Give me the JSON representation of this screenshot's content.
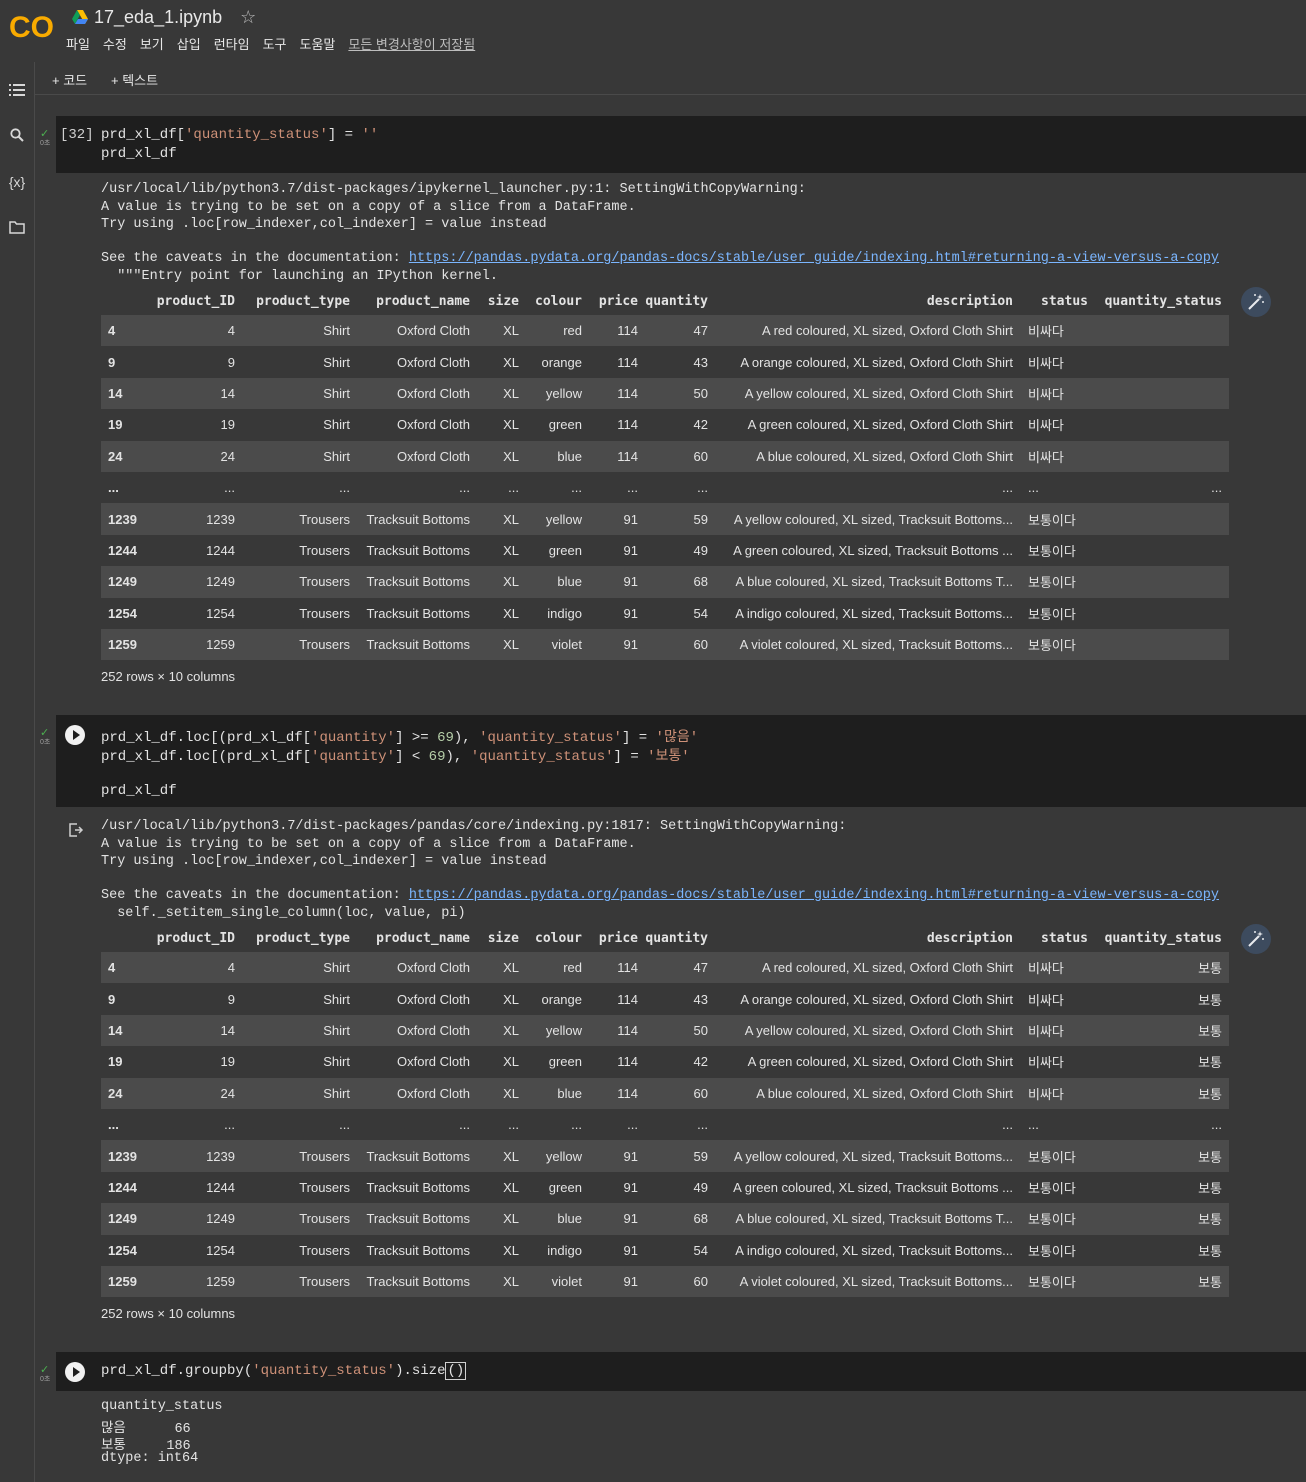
{
  "header": {
    "logo_text": "CO",
    "notebook_title": "17_eda_1.ipynb",
    "menu": [
      "파일",
      "수정",
      "보기",
      "삽입",
      "런타임",
      "도구",
      "도움말"
    ],
    "save_status": "모든 변경사항이 저장됨"
  },
  "toolbar": {
    "add_code": "+ 코드",
    "add_text": "+ 텍스트"
  },
  "rail": {
    "variables_icon": "{x}"
  },
  "secs_label": "0초",
  "cell1": {
    "exec_count": "[32]",
    "code": [
      "prd_xl_df['quantity_status'] = ''",
      "prd_xl_df"
    ],
    "warning": [
      "/usr/local/lib/python3.7/dist-packages/ipykernel_launcher.py:1: SettingWithCopyWarning:",
      "A value is trying to be set on a copy of a slice from a DataFrame.",
      "Try using .loc[row_indexer,col_indexer] = value instead"
    ],
    "caveat_prefix": "See the caveats in the documentation: ",
    "link": "https://pandas.pydata.org/pandas-docs/stable/user_guide/indexing.html#returning-a-view-versus-a-copy",
    "trailing": "  \"\"\"Entry point for launching an IPython kernel.",
    "shape": "252 rows × 10 columns"
  },
  "cell2": {
    "code": [
      "prd_xl_df.loc[(prd_xl_df['quantity'] >= 69), 'quantity_status'] = '많음'",
      "prd_xl_df.loc[(prd_xl_df['quantity'] < 69), 'quantity_status'] = '보통'",
      "",
      "prd_xl_df"
    ],
    "warning": [
      "/usr/local/lib/python3.7/dist-packages/pandas/core/indexing.py:1817: SettingWithCopyWarning:",
      "A value is trying to be set on a copy of a slice from a DataFrame.",
      "Try using .loc[row_indexer,col_indexer] = value instead"
    ],
    "caveat_prefix": "See the caveats in the documentation: ",
    "link": "https://pandas.pydata.org/pandas-docs/stable/user_guide/indexing.html#returning-a-view-versus-a-copy",
    "trailing": "  self._setitem_single_column(loc, value, pi)",
    "shape": "252 rows × 10 columns"
  },
  "cell3": {
    "code": "prd_xl_df.groupby('quantity_status').size()",
    "output": [
      "quantity_status",
      "많음      66",
      "보통     186",
      "dtype: int64"
    ]
  },
  "table": {
    "columns": [
      "",
      "product_ID",
      "product_type",
      "product_name",
      "size",
      "colour",
      "price",
      "quantity",
      "description",
      "status",
      "quantity_status"
    ],
    "rows1": [
      [
        "4",
        "4",
        "Shirt",
        "Oxford Cloth",
        "XL",
        "red",
        "114",
        "47",
        "A red coloured, XL sized, Oxford Cloth Shirt",
        "비싸다",
        ""
      ],
      [
        "9",
        "9",
        "Shirt",
        "Oxford Cloth",
        "XL",
        "orange",
        "114",
        "43",
        "A orange coloured, XL sized, Oxford Cloth Shirt",
        "비싸다",
        ""
      ],
      [
        "14",
        "14",
        "Shirt",
        "Oxford Cloth",
        "XL",
        "yellow",
        "114",
        "50",
        "A yellow coloured, XL sized, Oxford Cloth Shirt",
        "비싸다",
        ""
      ],
      [
        "19",
        "19",
        "Shirt",
        "Oxford Cloth",
        "XL",
        "green",
        "114",
        "42",
        "A green coloured, XL sized, Oxford Cloth Shirt",
        "비싸다",
        ""
      ],
      [
        "24",
        "24",
        "Shirt",
        "Oxford Cloth",
        "XL",
        "blue",
        "114",
        "60",
        "A blue coloured, XL sized, Oxford Cloth Shirt",
        "비싸다",
        ""
      ],
      [
        "...",
        "...",
        "...",
        "...",
        "...",
        "...",
        "...",
        "...",
        "...",
        "...",
        "..."
      ],
      [
        "1239",
        "1239",
        "Trousers",
        "Tracksuit Bottoms",
        "XL",
        "yellow",
        "91",
        "59",
        "A yellow coloured, XL sized, Tracksuit Bottoms...",
        "보통이다",
        ""
      ],
      [
        "1244",
        "1244",
        "Trousers",
        "Tracksuit Bottoms",
        "XL",
        "green",
        "91",
        "49",
        "A green coloured, XL sized, Tracksuit Bottoms ...",
        "보통이다",
        ""
      ],
      [
        "1249",
        "1249",
        "Trousers",
        "Tracksuit Bottoms",
        "XL",
        "blue",
        "91",
        "68",
        "A blue coloured, XL sized, Tracksuit Bottoms T...",
        "보통이다",
        ""
      ],
      [
        "1254",
        "1254",
        "Trousers",
        "Tracksuit Bottoms",
        "XL",
        "indigo",
        "91",
        "54",
        "A indigo coloured, XL sized, Tracksuit Bottoms...",
        "보통이다",
        ""
      ],
      [
        "1259",
        "1259",
        "Trousers",
        "Tracksuit Bottoms",
        "XL",
        "violet",
        "91",
        "60",
        "A violet coloured, XL sized, Tracksuit Bottoms...",
        "보통이다",
        ""
      ]
    ],
    "rows2": [
      [
        "4",
        "4",
        "Shirt",
        "Oxford Cloth",
        "XL",
        "red",
        "114",
        "47",
        "A red coloured, XL sized, Oxford Cloth Shirt",
        "비싸다",
        "보통"
      ],
      [
        "9",
        "9",
        "Shirt",
        "Oxford Cloth",
        "XL",
        "orange",
        "114",
        "43",
        "A orange coloured, XL sized, Oxford Cloth Shirt",
        "비싸다",
        "보통"
      ],
      [
        "14",
        "14",
        "Shirt",
        "Oxford Cloth",
        "XL",
        "yellow",
        "114",
        "50",
        "A yellow coloured, XL sized, Oxford Cloth Shirt",
        "비싸다",
        "보통"
      ],
      [
        "19",
        "19",
        "Shirt",
        "Oxford Cloth",
        "XL",
        "green",
        "114",
        "42",
        "A green coloured, XL sized, Oxford Cloth Shirt",
        "비싸다",
        "보통"
      ],
      [
        "24",
        "24",
        "Shirt",
        "Oxford Cloth",
        "XL",
        "blue",
        "114",
        "60",
        "A blue coloured, XL sized, Oxford Cloth Shirt",
        "비싸다",
        "보통"
      ],
      [
        "...",
        "...",
        "...",
        "...",
        "...",
        "...",
        "...",
        "...",
        "...",
        "...",
        "..."
      ],
      [
        "1239",
        "1239",
        "Trousers",
        "Tracksuit Bottoms",
        "XL",
        "yellow",
        "91",
        "59",
        "A yellow coloured, XL sized, Tracksuit Bottoms...",
        "보통이다",
        "보통"
      ],
      [
        "1244",
        "1244",
        "Trousers",
        "Tracksuit Bottoms",
        "XL",
        "green",
        "91",
        "49",
        "A green coloured, XL sized, Tracksuit Bottoms ...",
        "보통이다",
        "보통"
      ],
      [
        "1249",
        "1249",
        "Trousers",
        "Tracksuit Bottoms",
        "XL",
        "blue",
        "91",
        "68",
        "A blue coloured, XL sized, Tracksuit Bottoms T...",
        "보통이다",
        "보통"
      ],
      [
        "1254",
        "1254",
        "Trousers",
        "Tracksuit Bottoms",
        "XL",
        "indigo",
        "91",
        "54",
        "A indigo coloured, XL sized, Tracksuit Bottoms...",
        "보통이다",
        "보통"
      ],
      [
        "1259",
        "1259",
        "Trousers",
        "Tracksuit Bottoms",
        "XL",
        "violet",
        "91",
        "60",
        "A violet coloured, XL sized, Tracksuit Bottoms...",
        "보통이다",
        "보통"
      ]
    ]
  },
  "colors": {
    "page_bg": "#383838",
    "code_bg": "#1e1e1e",
    "row_stripe": "#4b4b4b",
    "string": "#ce9178",
    "number": "#b5cea8",
    "link": "#7bb6ff",
    "check": "#4caf50"
  }
}
